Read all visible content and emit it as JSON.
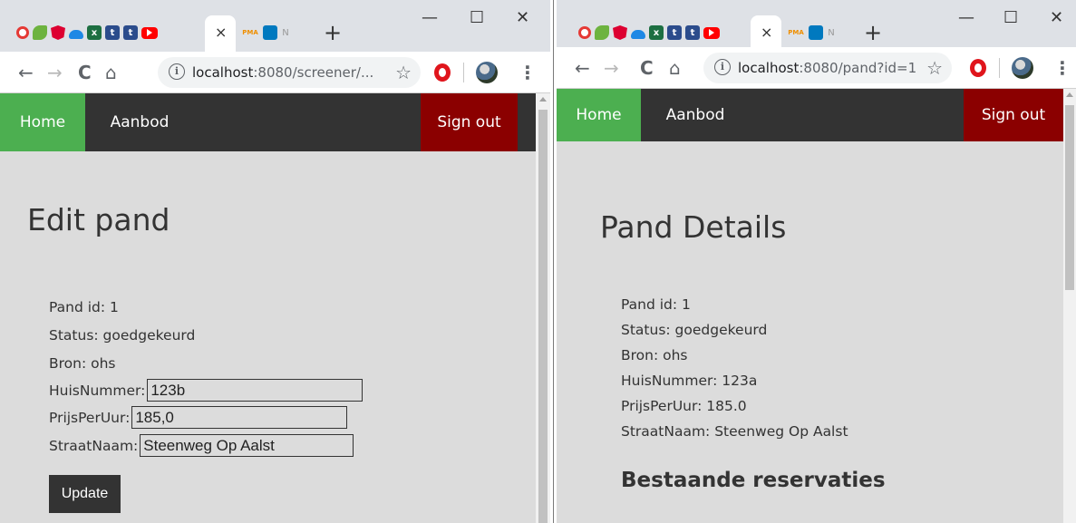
{
  "browser": {
    "tab_close_glyph": "×",
    "new_tab_glyph": "+",
    "minimize_glyph": "—",
    "maximize_glyph": "☐",
    "close_window_glyph": "✕",
    "back_glyph": "←",
    "forward_glyph": "→",
    "reload_glyph": "C",
    "home_glyph": "⌂",
    "info_glyph": "i",
    "star_glyph": "☆",
    "menu_glyph": "⋮",
    "favicons": {
      "excel": "x",
      "t1": "t",
      "t2": "t",
      "pma": "PMA",
      "n": "N"
    }
  },
  "left": {
    "url_host": "localhost",
    "url_path": ":8080/screener/...",
    "nav": {
      "home": "Home",
      "aanbod": "Aanbod",
      "signout": "Sign out"
    },
    "title": "Edit pand",
    "pand_id": "Pand id: 1",
    "status": "Status: goedgekeurd",
    "bron": "Bron: ohs",
    "huisnummer_label": "HuisNummer:",
    "huisnummer_value": "123b",
    "prijsperuur_label": "PrijsPerUur:",
    "prijsperuur_value": "185,0",
    "straatnaam_label": "StraatNaam:",
    "straatnaam_value": "Steenweg Op Aalst",
    "update_button": "Update"
  },
  "right": {
    "url_host": "localhost",
    "url_path": ":8080/pand?id=1",
    "nav": {
      "home": "Home",
      "aanbod": "Aanbod",
      "signout": "Sign out"
    },
    "title": "Pand Details",
    "pand_id": "Pand id: 1",
    "status": "Status: goedgekeurd",
    "bron": "Bron: ohs",
    "huisnummer": "HuisNummer: 123a",
    "prijsperuur": "PrijsPerUur: 185.0",
    "straatnaam": "StraatNaam: Steenweg Op Aalst",
    "reservaties_heading": "Bestaande reservaties"
  },
  "colors": {
    "nav_bg": "#333333",
    "home_green": "#4caf50",
    "signout_red": "#8b0000",
    "page_bg": "#dcdcdc"
  }
}
